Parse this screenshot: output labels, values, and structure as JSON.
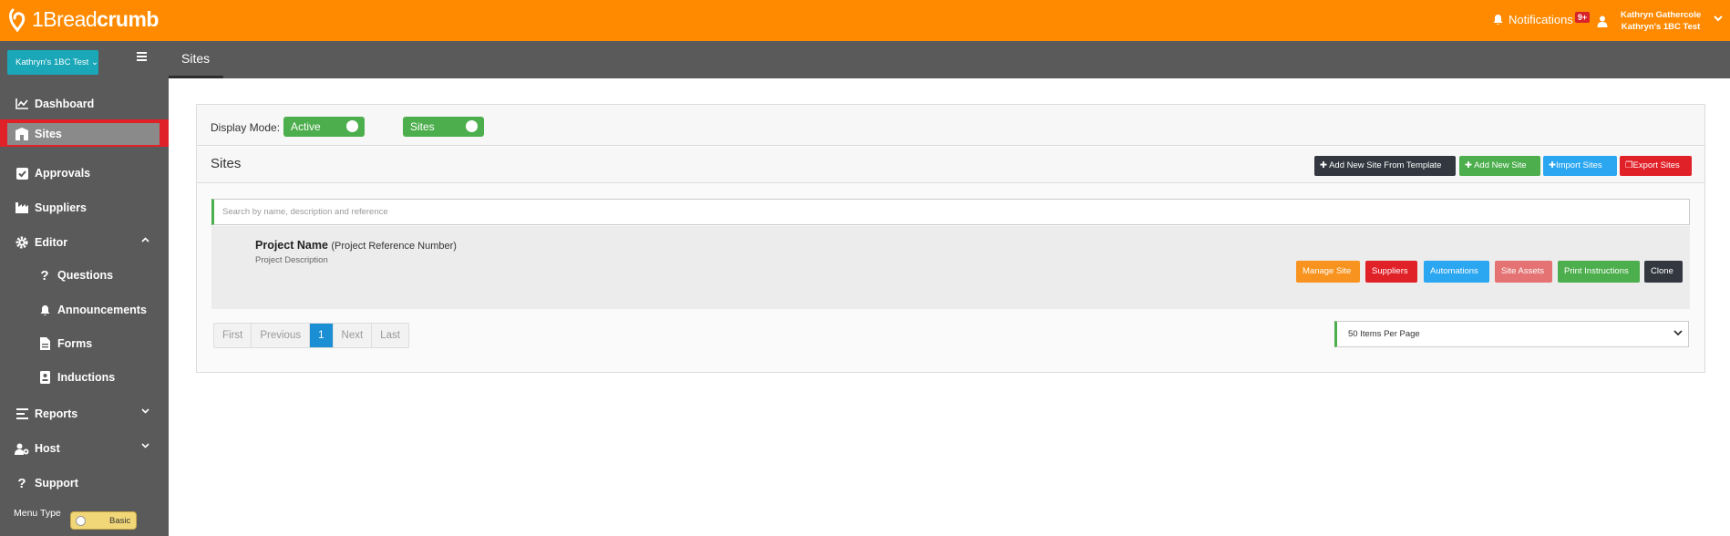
{
  "brand": {
    "logo_thin": "1Bread",
    "logo_bold": "crumb"
  },
  "header": {
    "notifications_label": "Notifications",
    "notifications_badge": "9+",
    "user_name": "Kathryn Gathercole",
    "user_org": "Kathryn's 1BC Test"
  },
  "site_selector": {
    "label": "Kathryn's 1BC Test"
  },
  "page_tab": "Sites",
  "sidebar": {
    "items": [
      {
        "label": "Dashboard",
        "icon": "chart-line-icon"
      },
      {
        "label": "Sites",
        "icon": "building-icon",
        "active": true
      },
      {
        "label": "Approvals",
        "icon": "checkbox-icon"
      },
      {
        "label": "Suppliers",
        "icon": "factory-icon"
      },
      {
        "label": "Editor",
        "icon": "gear-icon",
        "expanded": true
      },
      {
        "label": "Questions",
        "icon": "question-icon"
      },
      {
        "label": "Announcements",
        "icon": "bell-icon"
      },
      {
        "label": "Forms",
        "icon": "document-icon"
      },
      {
        "label": "Inductions",
        "icon": "id-card-icon"
      },
      {
        "label": "Reports",
        "icon": "list-icon"
      },
      {
        "label": "Host",
        "icon": "user-gear-icon"
      },
      {
        "label": "Support",
        "icon": "question-icon"
      }
    ],
    "menu_type_label": "Menu Type",
    "menu_type_value": "Basic"
  },
  "display_mode": {
    "label": "Display Mode:",
    "toggle_active": "Active",
    "toggle_sites": "Sites"
  },
  "sites_section": {
    "title": "Sites",
    "buttons": {
      "add_from_template": "Add New Site From Template",
      "add_new": "Add New Site",
      "import": "Import Sites",
      "export": "Export Sites"
    }
  },
  "search": {
    "placeholder": "Search by name, description and reference"
  },
  "site_card": {
    "name": "Project Name",
    "reference": "(Project Reference Number)",
    "description": "Project Description",
    "actions": {
      "manage": "Manage Site",
      "suppliers": "Suppliers",
      "automations": "Automations",
      "assets": "Site Assets",
      "print": "Print Instructions",
      "clone": "Clone"
    }
  },
  "pagination": {
    "first": "First",
    "previous": "Previous",
    "current": "1",
    "next": "Next",
    "last": "Last"
  },
  "per_page": {
    "selected": "50 Items Per Page"
  },
  "colors": {
    "header": "#ff8a00",
    "sidebar": "#5a5a5a",
    "selector": "#1aa7b8",
    "green": "#4cae4c",
    "blue": "#2ba6f0",
    "red": "#e02128",
    "dark": "#333840"
  }
}
